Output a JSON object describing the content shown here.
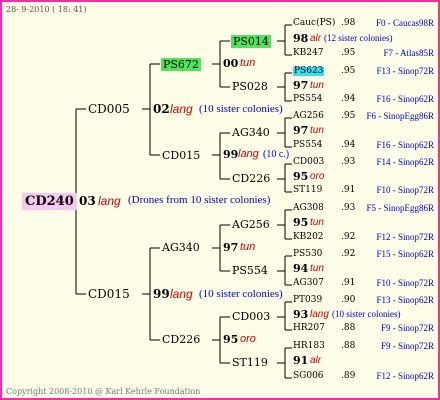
{
  "header": {
    "date": "28- 9-2010 ( 18: 41)"
  },
  "footer": {
    "copyright": "Copyright 2008-2010 @ Karl Kehrle Foundation"
  },
  "colors": {
    "frame": "#ff2aa0",
    "background": "#fefde8",
    "line": "#000000",
    "link": "#0000c8",
    "lang": "#cc0000",
    "root_highlight": "#f8c8f0",
    "gen_highlight": "#52e35a",
    "leaf_highlight": "#33e0ee"
  },
  "root": {
    "name": "CD240",
    "num": "03",
    "lang": "lang",
    "note": "(Drones from 10 sister colonies)"
  },
  "gen1": [
    {
      "name": "CD005",
      "num": "02",
      "lang": "lang",
      "note": "(10 sister colonies)"
    },
    {
      "name": "CD015",
      "num": "99",
      "lang": "lang",
      "note": "(10 sister colonies)"
    }
  ],
  "gen2": [
    {
      "name": "PS672",
      "num": "00",
      "lang": "tun",
      "note": ""
    },
    {
      "name": "CD015",
      "num": "99",
      "lang": "lang",
      "note": "(10 c.)"
    },
    {
      "name": "AG340",
      "num": "97",
      "lang": "tun",
      "note": ""
    },
    {
      "name": "CD226",
      "num": "95",
      "lang": "oro",
      "note": ""
    }
  ],
  "gen3": [
    "PS014",
    "PS028",
    "AG340",
    "CD226",
    "AG256",
    "PS554",
    "CD003",
    "ST119"
  ],
  "gen4": [
    {
      "name": "Cauc(PS)",
      "score": ".98",
      "tag": "F0 - Caucas98R"
    },
    {
      "name": "98",
      "lang": "alr",
      "note": "(12 sister colonies)"
    },
    {
      "name": "KB247",
      "score": ".95",
      "tag": "F7 - Atlas85R"
    },
    {
      "name": "PS623",
      "score": ".95",
      "tag": "F13 - Sinop72R"
    },
    {
      "name": "97",
      "lang": "tun",
      "note": ""
    },
    {
      "name": "PS554",
      "score": ".94",
      "tag": "F16 - Sinop62R"
    },
    {
      "name": "AG256",
      "score": ".95",
      "tag": "F6 - SinopEgg86R"
    },
    {
      "name": "97",
      "lang": "tun",
      "note": ""
    },
    {
      "name": "PS554",
      "score": ".94",
      "tag": "F16 - Sinop62R"
    },
    {
      "name": "CD003",
      "score": ".93",
      "tag": "F14 - Sinop62R"
    },
    {
      "name": "95",
      "lang": "oro",
      "note": ""
    },
    {
      "name": "ST119",
      "score": ".91",
      "tag": "F10 - Sinop72R"
    },
    {
      "name": "AG308",
      "score": ".93",
      "tag": "F5 - SinopEgg86R"
    },
    {
      "name": "95",
      "lang": "tun",
      "note": ""
    },
    {
      "name": "KB202",
      "score": ".92",
      "tag": "F12 - Sinop72R"
    },
    {
      "name": "PS530",
      "score": ".92",
      "tag": "F15 - Sinop62R"
    },
    {
      "name": "94",
      "lang": "tun",
      "note": ""
    },
    {
      "name": "AG307",
      "score": ".91",
      "tag": "F10 - Sinop72R"
    },
    {
      "name": "PT039",
      "score": ".90",
      "tag": "F13 - Sinop62R"
    },
    {
      "name": "93",
      "lang": "lang",
      "note": "(10 sister colonies)"
    },
    {
      "name": "HR207",
      "score": ".88",
      "tag": "F9 - Sinop72R"
    },
    {
      "name": "HR183",
      "score": ".88",
      "tag": "F9 - Sinop72R"
    },
    {
      "name": "91",
      "lang": "alr",
      "note": ""
    },
    {
      "name": "SG006",
      "score": ".89",
      "tag": "F12 - Sinop62R"
    }
  ]
}
